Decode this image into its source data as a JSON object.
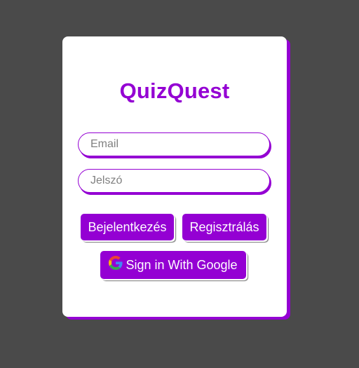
{
  "app": {
    "title": "QuizQuest"
  },
  "form": {
    "email_placeholder": "Email",
    "password_placeholder": "Jelszó",
    "email_value": "",
    "password_value": ""
  },
  "buttons": {
    "login_label": "Bejelentkezés",
    "register_label": "Regisztrálás",
    "google_label": "Sign in With Google",
    "google_icon": "google-icon"
  },
  "colors": {
    "background": "#4a4a4a",
    "accent": "#9400d3",
    "card": "#ffffff"
  }
}
